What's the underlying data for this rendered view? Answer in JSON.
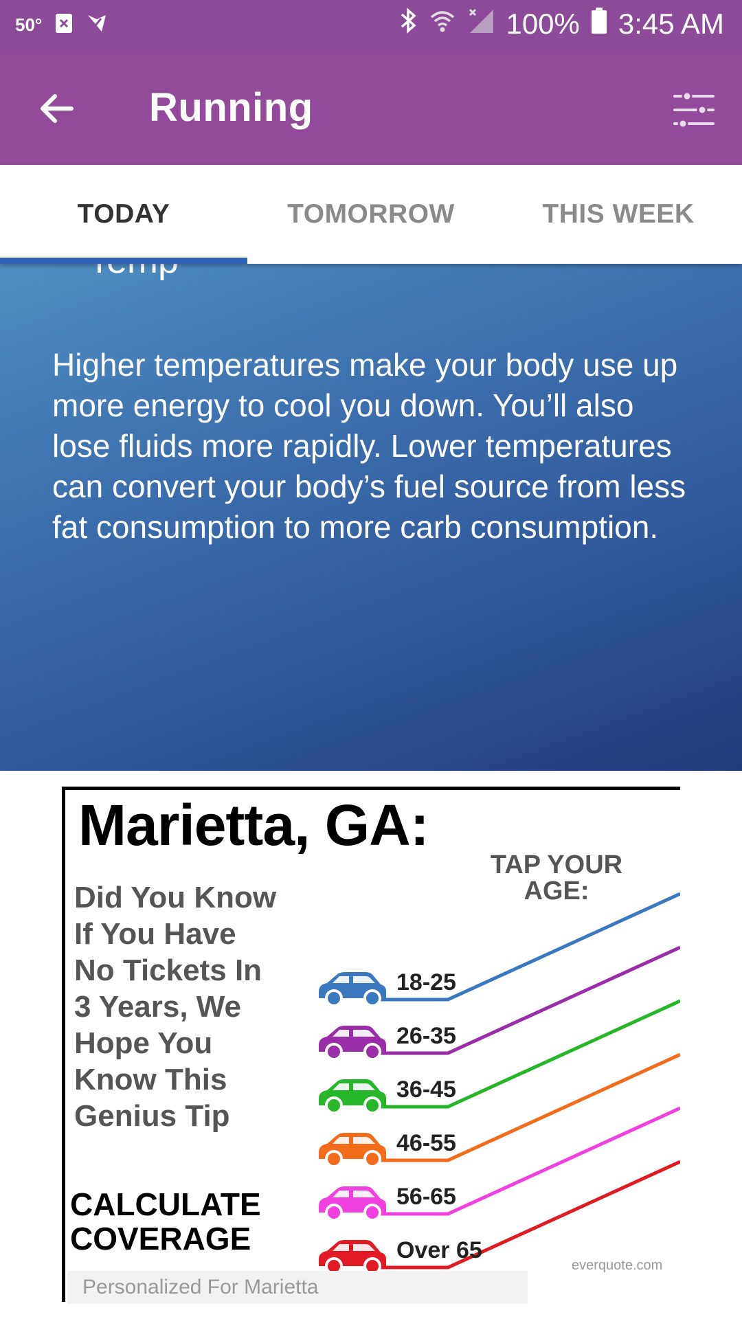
{
  "status_bar": {
    "temperature": "50°",
    "battery": "100%",
    "time": "3:45 AM"
  },
  "app_bar": {
    "title": "Running"
  },
  "tabs": [
    {
      "label": "TODAY",
      "active": true
    },
    {
      "label": "TOMORROW",
      "active": false
    },
    {
      "label": "THIS WEEK",
      "active": false
    }
  ],
  "card": {
    "heading": "Temp",
    "body": "Higher temperatures make your body use up more energy to cool you down. You’ll also lose fluids more rapidly. Lower temperatures can convert your body’s fuel source from less fat consumption to more carb consumption."
  },
  "ad": {
    "city": "Marietta, GA:",
    "tap_prompt": "TAP YOUR AGE:",
    "question_lines": [
      "Did You Know",
      "If You Have",
      "No Tickets In",
      "3 Years, We",
      "Hope You",
      "Know This",
      "Genius Tip"
    ],
    "cta_lines": [
      "CALCULATE",
      "COVERAGE"
    ],
    "source": "everquote.com",
    "footer": "Personalized For Marietta",
    "age_groups": [
      {
        "label": "18-25",
        "color": "#3a78c0"
      },
      {
        "label": "26-35",
        "color": "#9a2ea8"
      },
      {
        "label": "36-45",
        "color": "#27b52a"
      },
      {
        "label": "46-55",
        "color": "#f26c1c"
      },
      {
        "label": "56-65",
        "color": "#f040e0"
      },
      {
        "label": "Over 65",
        "color": "#e01b24"
      }
    ]
  },
  "colors": {
    "status_bar": "#8e4a9a",
    "app_bar": "#934a9b",
    "tab_indicator": "#2f62b5"
  }
}
